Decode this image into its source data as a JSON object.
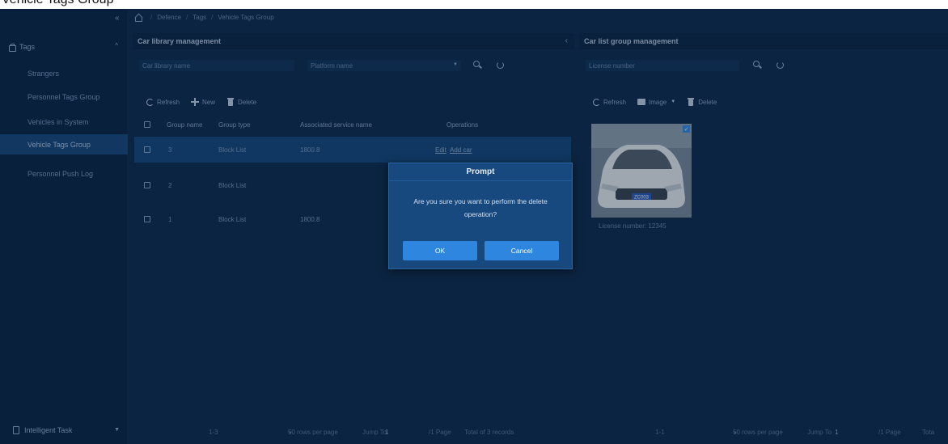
{
  "caption": "Vehicle Tags Group",
  "sidebar": {
    "collapse_icon": "«",
    "section_label": "Tags",
    "items": [
      {
        "label": "Strangers",
        "active": false
      },
      {
        "label": "Personnel Tags Group",
        "active": false
      },
      {
        "label": "Vehicles in System",
        "active": false
      },
      {
        "label": "Vehicle Tags Group",
        "active": true
      },
      {
        "label": "Personnel Push Log",
        "active": false
      }
    ],
    "footer_label": "Intelligent Task"
  },
  "breadcrumb": [
    "Defence",
    "Tags",
    "Vehicle Tags Group"
  ],
  "left_panel": {
    "title": "Car library management",
    "car_library_placeholder": "Car library name",
    "platform_placeholder": "Platform name",
    "toolbar": {
      "refresh": "Refresh",
      "new": "New",
      "delete": "Delete"
    },
    "columns": [
      "Group name",
      "Group type",
      "Associated service name",
      "Operations"
    ],
    "rows": [
      {
        "name": "3",
        "type": "Block List",
        "service": "1800.8",
        "op_edit": "Edit",
        "op_add": "Add car",
        "selected": true
      },
      {
        "name": "2",
        "type": "Block List",
        "service": "",
        "op_edit": "",
        "op_add": "",
        "selected": false
      },
      {
        "name": "1",
        "type": "Block List",
        "service": "1800.8",
        "op_edit": "",
        "op_add": "",
        "selected": false
      }
    ],
    "pager": {
      "range": "1-3",
      "per_page": "50 rows per page",
      "jump_label": "Jump To",
      "jump_value": "1",
      "pages": "/1 Page",
      "total": "Total of 3 records"
    }
  },
  "right_panel": {
    "title": "Car list group management",
    "license_placeholder": "License number",
    "toolbar": {
      "refresh": "Refresh",
      "image": "Image",
      "delete": "Delete"
    },
    "card": {
      "plate": "ZC003",
      "caption": "License number:  12345"
    },
    "pager": {
      "range": "1-1",
      "per_page": "50 rows per page",
      "jump_label": "Jump To",
      "jump_value": "1",
      "pages": "/1 Page",
      "total": "Tota"
    }
  },
  "modal": {
    "title": "Prompt",
    "message": "Are you sure you want to perform the delete operation?",
    "ok": "OK",
    "cancel": "Cancel"
  },
  "colors": {
    "accent": "#2f86de",
    "background": "#0d2a4b",
    "selected_row": "#13487c",
    "modal_bg": "#17497f"
  }
}
